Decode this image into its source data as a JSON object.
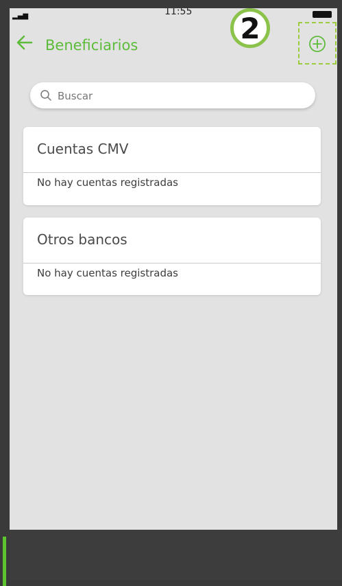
{
  "status_bar": {
    "time": "11:55"
  },
  "header": {
    "title": "Beneficiarios",
    "back_icon": "arrow-left-icon",
    "add_icon": "plus-circle-icon",
    "step_badge": "2"
  },
  "search": {
    "placeholder": "Buscar",
    "value": ""
  },
  "sections": [
    {
      "title": "Cuentas CMV",
      "empty_message": "No hay cuentas registradas"
    },
    {
      "title": "Otros bancos",
      "empty_message": "No hay cuentas registradas"
    }
  ],
  "colors": {
    "accent": "#5dbb3a",
    "badge_border": "#8bc34a",
    "background": "#e1e2e1",
    "card": "#ffffff"
  }
}
